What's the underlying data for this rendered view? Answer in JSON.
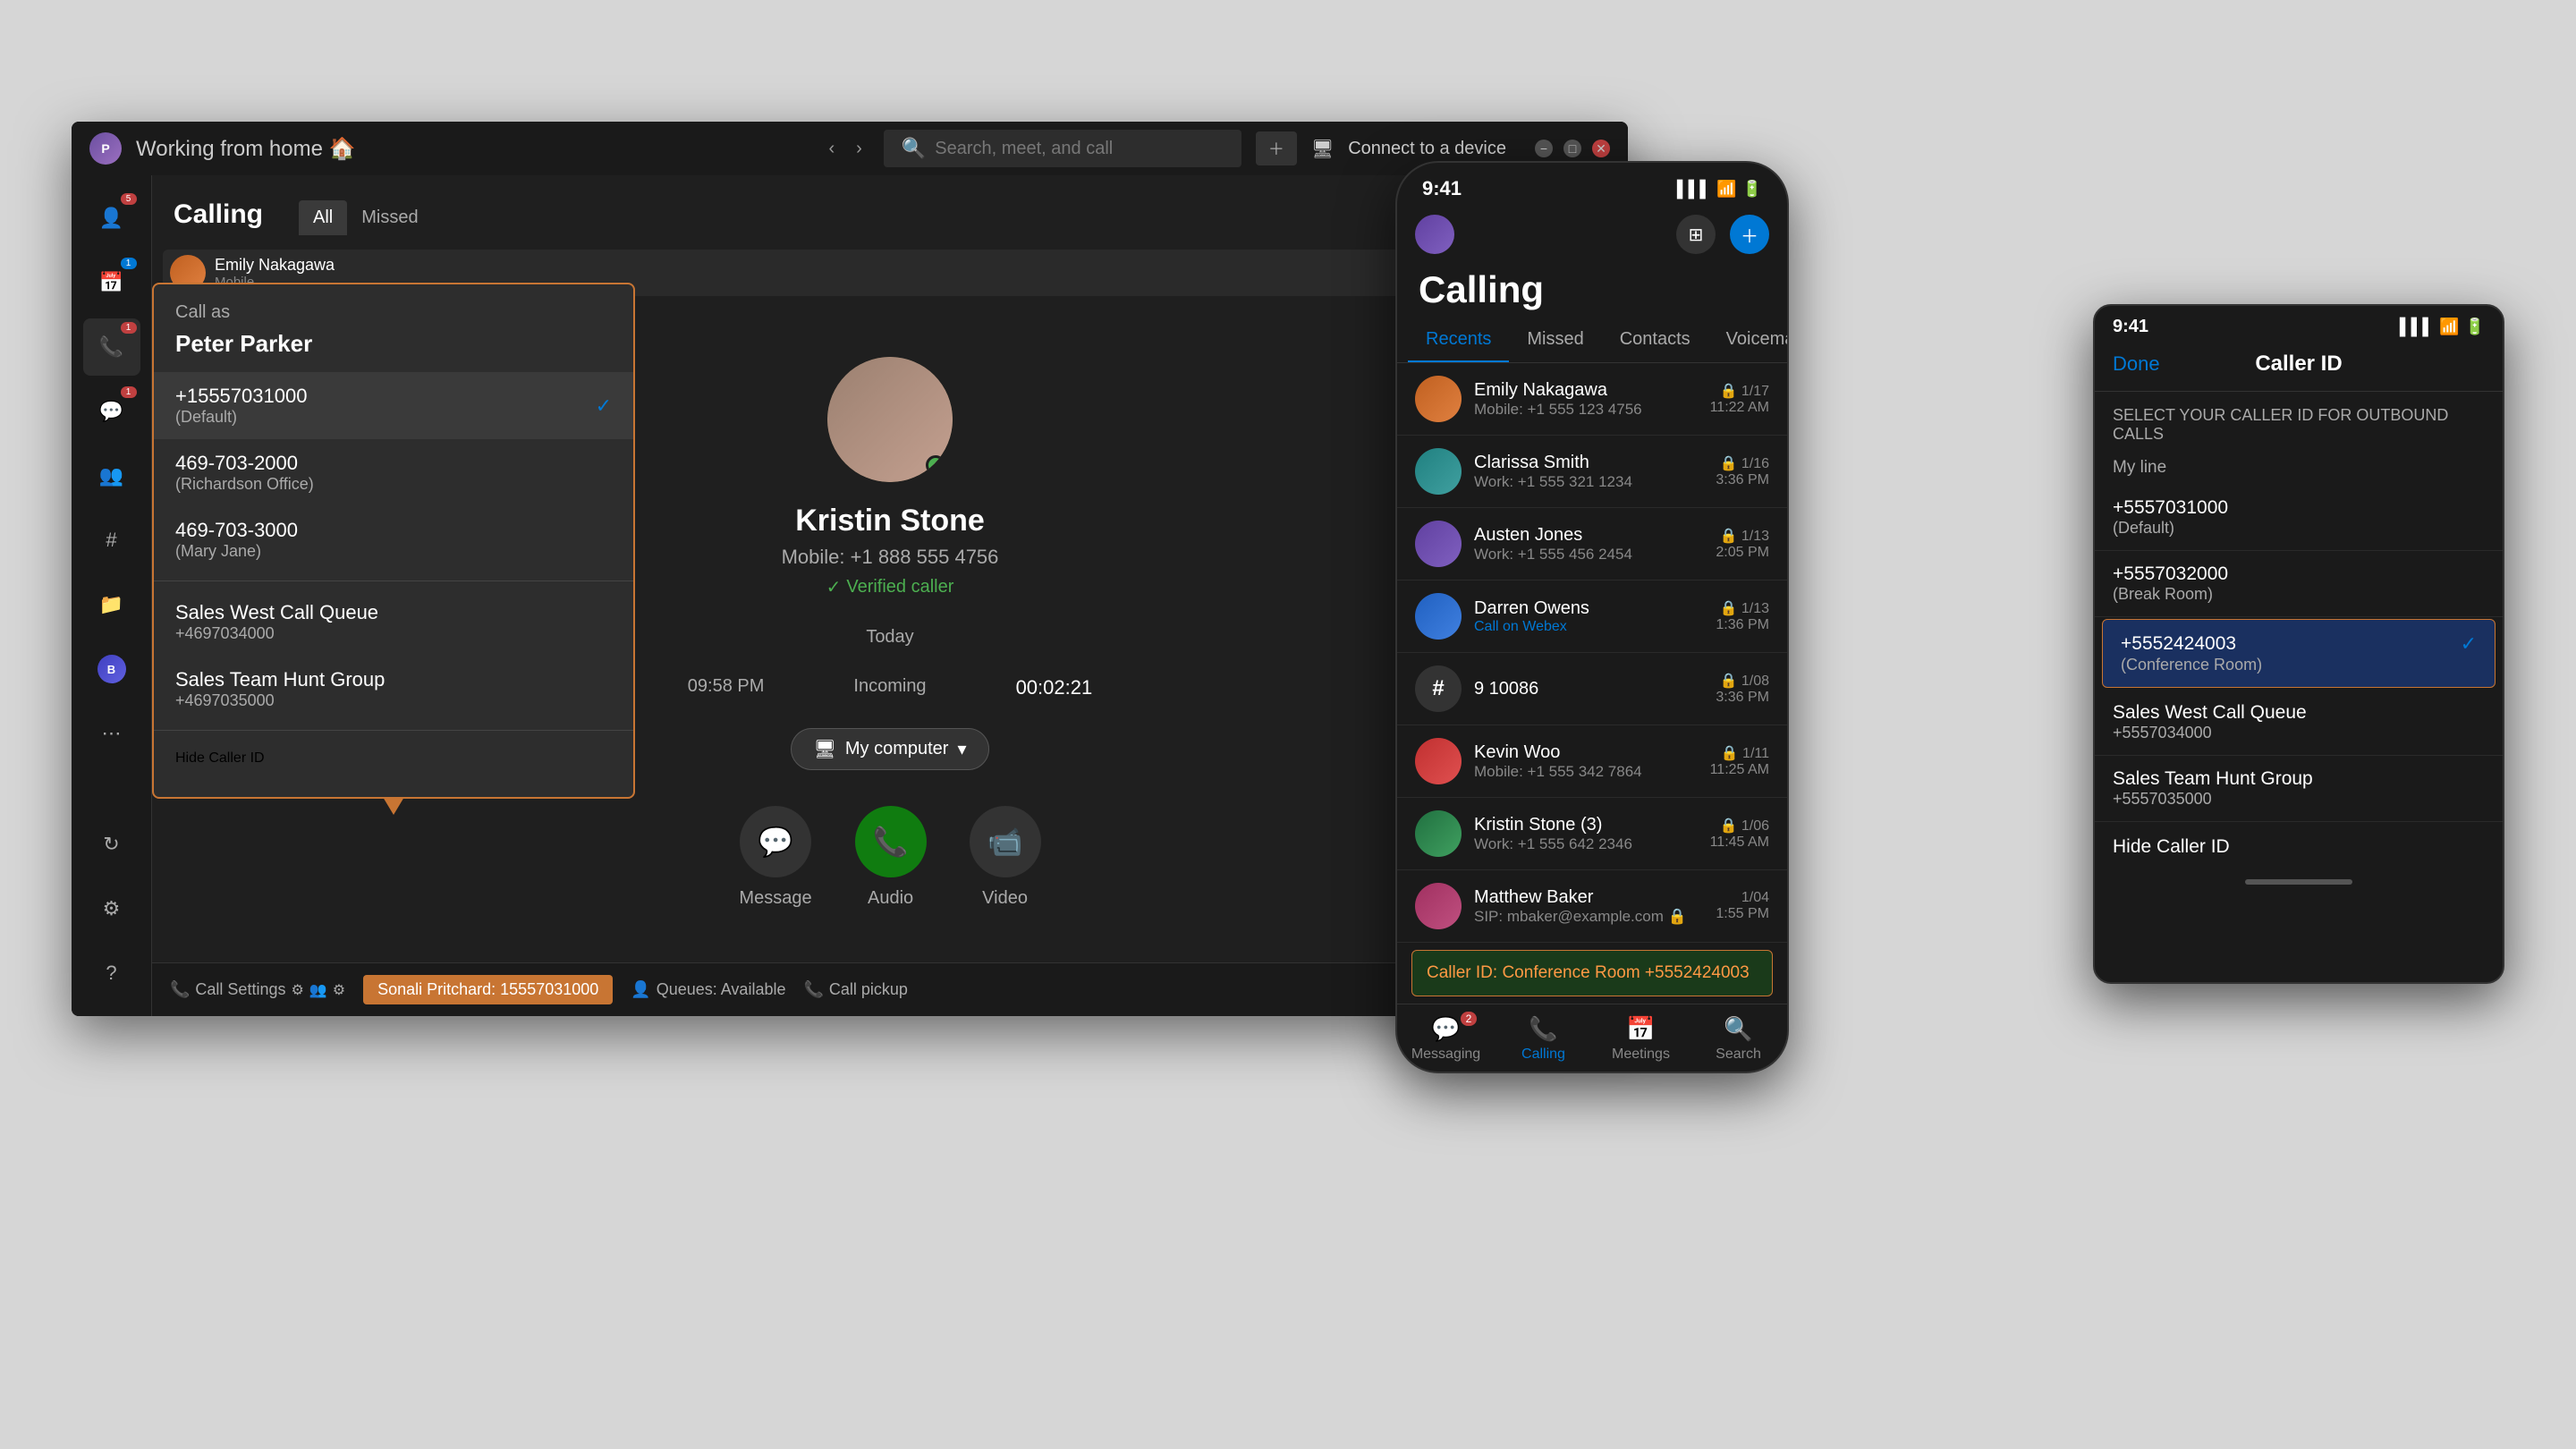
{
  "window": {
    "title": "Working from home 🏠",
    "search_placeholder": "Search, meet, and call",
    "connect_label": "Connect to a device"
  },
  "sidebar": {
    "items": [
      {
        "icon": "👤",
        "badge": "5",
        "badge_type": "red",
        "label": "Activity"
      },
      {
        "icon": "📅",
        "badge": "1",
        "badge_type": "blue",
        "label": "Calendar"
      },
      {
        "icon": "📞",
        "badge": "1",
        "badge_type": "red",
        "label": "Calls"
      },
      {
        "icon": "💬",
        "badge": "1",
        "badge_type": "red",
        "label": "Chat"
      },
      {
        "icon": "👥",
        "label": "Teams"
      },
      {
        "icon": "#",
        "label": "Channels"
      },
      {
        "icon": "📁",
        "label": "Files"
      },
      {
        "icon": "B",
        "avatar": true,
        "label": ""
      },
      {
        "icon": "⋯",
        "label": "More"
      }
    ]
  },
  "calling": {
    "title": "Calling",
    "tabs": [
      "All",
      "Missed"
    ]
  },
  "caller_id_dropdown": {
    "title": "Call as",
    "user": "Peter Parker",
    "options": [
      {
        "number": "+15557031000",
        "label": "(Default)",
        "selected": true
      },
      {
        "number": "469-703-2000",
        "label": "(Richardson Office)",
        "selected": false
      },
      {
        "number": "469-703-3000",
        "label": "(Mary Jane)",
        "selected": false
      },
      {
        "number": "Sales West Call Queue",
        "label": "+4697034000",
        "selected": false
      },
      {
        "number": "Sales Team Hunt Group",
        "label": "+4697035000",
        "selected": false
      }
    ],
    "hide_label": "Hide Caller ID"
  },
  "contact": {
    "name": "Kristin Stone",
    "phone": "Mobile: +1 888 555 4756",
    "verified": "Verified caller",
    "call_section": "Today",
    "call_time": "09:58 PM",
    "call_type": "Incoming",
    "call_duration": "00:02:21",
    "device": "My computer"
  },
  "call_actions": [
    {
      "icon": "💬",
      "label": "Message"
    },
    {
      "icon": "📞",
      "label": "Audio"
    },
    {
      "icon": "📹",
      "label": "Video"
    }
  ],
  "status_bar": {
    "call_settings": "Call Settings",
    "caller_highlight": "Sonali Pritchard: 15557031000",
    "queues": "Queues: Available",
    "call_pickup": "Call pickup"
  },
  "mobile_left": {
    "time": "9:41",
    "calling_title": "Calling",
    "tabs": [
      "Recents",
      "Missed",
      "Contacts",
      "Voicemail"
    ],
    "active_tab": "Recents",
    "contacts": [
      {
        "name": "Emily Nakagawa",
        "detail": "Mobile: +1 555 123 4756",
        "date": "1/17",
        "time": "11:22 AM",
        "color": "av-orange"
      },
      {
        "name": "Clarissa Smith",
        "detail": "Work: +1 555 321 1234",
        "date": "1/16",
        "time": "3:36 PM",
        "color": "av-teal"
      },
      {
        "name": "Austen Jones",
        "detail": "Work: +1 555 456 2454",
        "date": "1/13",
        "time": "2:05 PM",
        "color": "av-purple"
      },
      {
        "name": "Darren Owens",
        "detail": "Call on Webex",
        "date": "1/13",
        "time": "1:36 PM",
        "color": "av-blue",
        "webex": true
      },
      {
        "name": "9 10086",
        "detail": "",
        "date": "1/08",
        "time": "3:36 PM",
        "hash": true
      },
      {
        "name": "Kevin Woo",
        "detail": "Mobile: +1 555 342 7864",
        "date": "1/11",
        "time": "11:25 AM",
        "color": "av-red"
      },
      {
        "name": "Kristin Stone (3)",
        "detail": "Work: +1 555 642 2346",
        "date": "1/06",
        "time": "11:45 AM",
        "color": "av-green"
      },
      {
        "name": "Matthew Baker",
        "detail": "SIP: mbaker@example.com",
        "date": "1/04",
        "time": "1:55 PM",
        "color": "av-pink"
      }
    ],
    "caller_id_banner": "Caller ID: Conference Room +5552424003",
    "nav_items": [
      {
        "icon": "💬",
        "label": "Messaging",
        "badge": "2"
      },
      {
        "icon": "📞",
        "label": "Calling",
        "active": true
      },
      {
        "icon": "📅",
        "label": "Meetings"
      },
      {
        "icon": "🔍",
        "label": "Search"
      }
    ]
  },
  "mobile_right": {
    "time": "9:41",
    "done_label": "Done",
    "title": "Caller ID",
    "subtitle": "SELECT YOUR CALLER ID FOR OUTBOUND CALLS",
    "my_line_label": "My line",
    "options": [
      {
        "number": "+5557031000",
        "label": "(Default)",
        "selected": false
      },
      {
        "number": "+5557032000",
        "label": "(Break Room)",
        "selected": false
      },
      {
        "number": "+5552424003",
        "label": "(Conference Room)",
        "selected": true
      },
      {
        "number": "Sales West Call Queue",
        "label": "+5557034000",
        "selected": false
      },
      {
        "number": "Sales Team Hunt Group",
        "label": "+5557035000",
        "selected": false
      }
    ],
    "hide_label": "Hide Caller ID"
  },
  "icons": {
    "check": "✓",
    "verified": "✓",
    "monitor": "🖥",
    "chevron_down": "▾",
    "phone_green": "📞",
    "message": "💬",
    "video": "📹",
    "search": "🔍",
    "settings": "⚙",
    "signal": "▌▌▌",
    "wifi": "📶",
    "battery": "🔋"
  }
}
